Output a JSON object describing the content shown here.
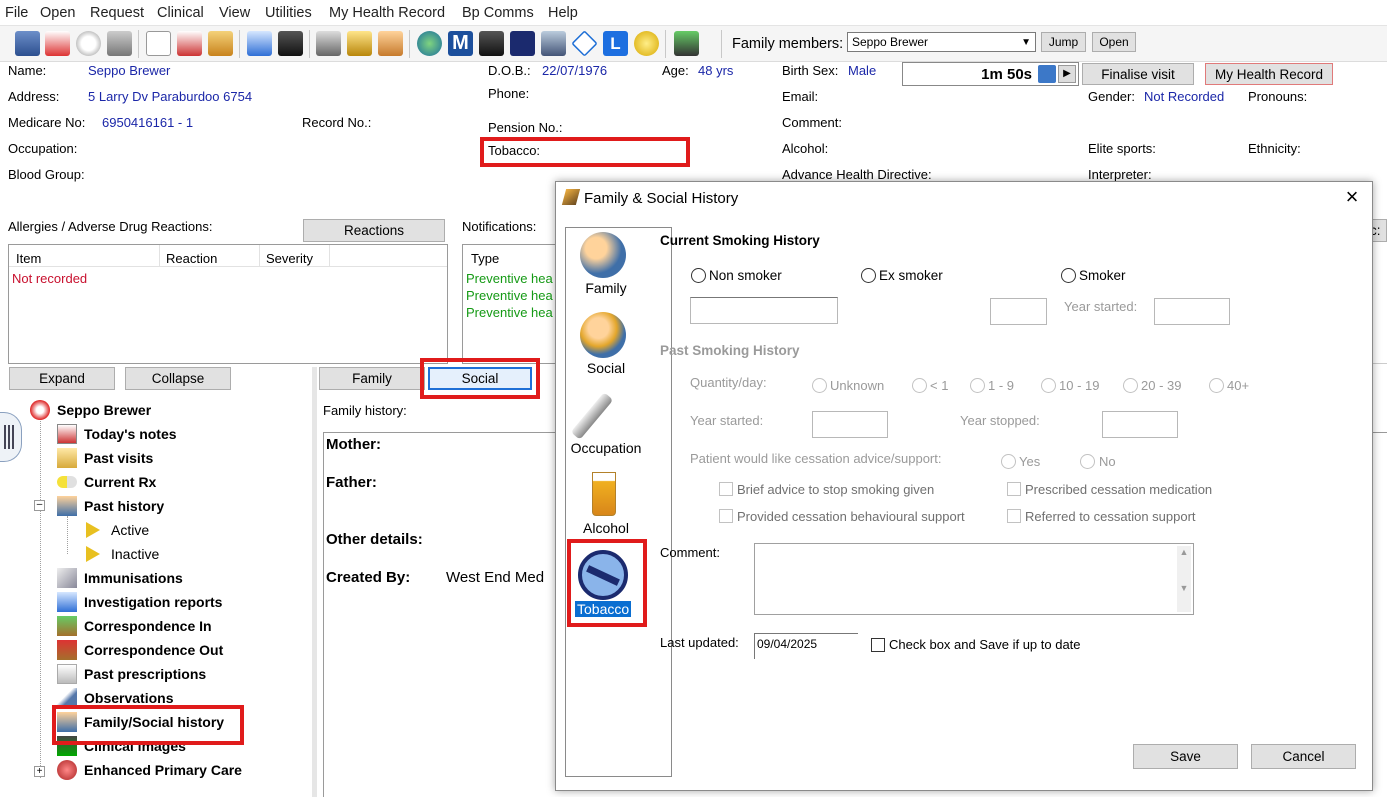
{
  "menu": [
    "File",
    "Open",
    "Request",
    "Clinical",
    "View",
    "Utilities",
    "My Health Record",
    "Bp Comms",
    "Help"
  ],
  "toolbar": {
    "family_members_label": "Family members:",
    "family_member_selected": "Seppo Brewer",
    "jump_label": "Jump",
    "open_label": "Open",
    "timer": "1m 50s",
    "finalise_label": "Finalise visit",
    "mhr_label": "My Health Record"
  },
  "patient": {
    "name_label": "Name:",
    "name": "Seppo Brewer",
    "address_label": "Address:",
    "address": "5 Larry Dv  Paraburdoo  6754",
    "medicare_label": "Medicare No:",
    "medicare": "6950416161 - 1",
    "record_label": "Record No.:",
    "occupation_label": "Occupation:",
    "blood_label": "Blood Group:",
    "dob_label": "D.O.B.:",
    "dob": "22/07/1976",
    "age_label": "Age:",
    "age": "48 yrs",
    "phone_label": "Phone:",
    "pension_label": "Pension No.:",
    "tobacco_label": "Tobacco:",
    "birthsex_label": "Birth Sex:",
    "birthsex": "Male",
    "email_label": "Email:",
    "comment_label": "Comment:",
    "alcohol_label": "Alcohol:",
    "ahd_label": "Advance Health Directive:",
    "gender_label": "Gender:",
    "gender": "Not Recorded",
    "pronouns_label": "Pronouns:",
    "elite_label": "Elite sports:",
    "ethnicity_label": "Ethnicity:",
    "interpreter_label": "Interpreter:"
  },
  "allergies": {
    "label": "Allergies / Adverse Drug Reactions:",
    "reactions_button": "Reactions",
    "columns": [
      "Item",
      "Reaction",
      "Severity"
    ],
    "not_recorded": "Not recorded"
  },
  "notifications": {
    "label": "Notifications:",
    "column": "Type",
    "rows": [
      "Preventive hea",
      "Preventive hea",
      "Preventive hea"
    ],
    "edge_button": "c:"
  },
  "tree": {
    "expand": "Expand",
    "collapse": "Collapse",
    "root": "Seppo Brewer",
    "items": [
      "Today's notes",
      "Past visits",
      "Current Rx",
      "Past history",
      "Immunisations",
      "Investigation reports",
      "Correspondence In",
      "Correspondence Out",
      "Past prescriptions",
      "Observations",
      "Family/Social history",
      "Clinical images",
      "Enhanced Primary Care"
    ],
    "sub_items": [
      "Active",
      "Inactive"
    ]
  },
  "tabs": {
    "family": "Family",
    "social": "Social"
  },
  "family_history": {
    "label": "Family history:",
    "mother": "Mother:",
    "father": "Father:",
    "other": "Other details:",
    "created_by": "Created By:",
    "created_by_value": "West End Med"
  },
  "dialog": {
    "title": "Family & Social History",
    "categories": [
      "Family",
      "Social",
      "Occupation",
      "Alcohol",
      "Tobacco"
    ],
    "current_heading": "Current Smoking History",
    "non_smoker": "Non smoker",
    "ex_smoker": "Ex smoker",
    "smoker": "Smoker",
    "year_started": "Year started:",
    "past_heading": "Past Smoking History",
    "quantity_label": "Quantity/day:",
    "quantity_options": [
      "Unknown",
      "< 1",
      "1 - 9",
      "10 - 19",
      "20 - 39",
      "40+"
    ],
    "past_year_started": "Year started:",
    "year_stopped": "Year stopped:",
    "cessation_label": "Patient would like cessation advice/support:",
    "yes": "Yes",
    "no": "No",
    "brief_advice": "Brief advice to stop smoking given",
    "prescribed": "Prescribed cessation medication",
    "behavioural": "Provided cessation behavioural support",
    "referred": "Referred to cessation support",
    "comment_label": "Comment:",
    "last_updated_label": "Last updated:",
    "last_updated": "09/04/2025",
    "check_save": "Check box and Save if up to date",
    "save": "Save",
    "cancel": "Cancel"
  }
}
